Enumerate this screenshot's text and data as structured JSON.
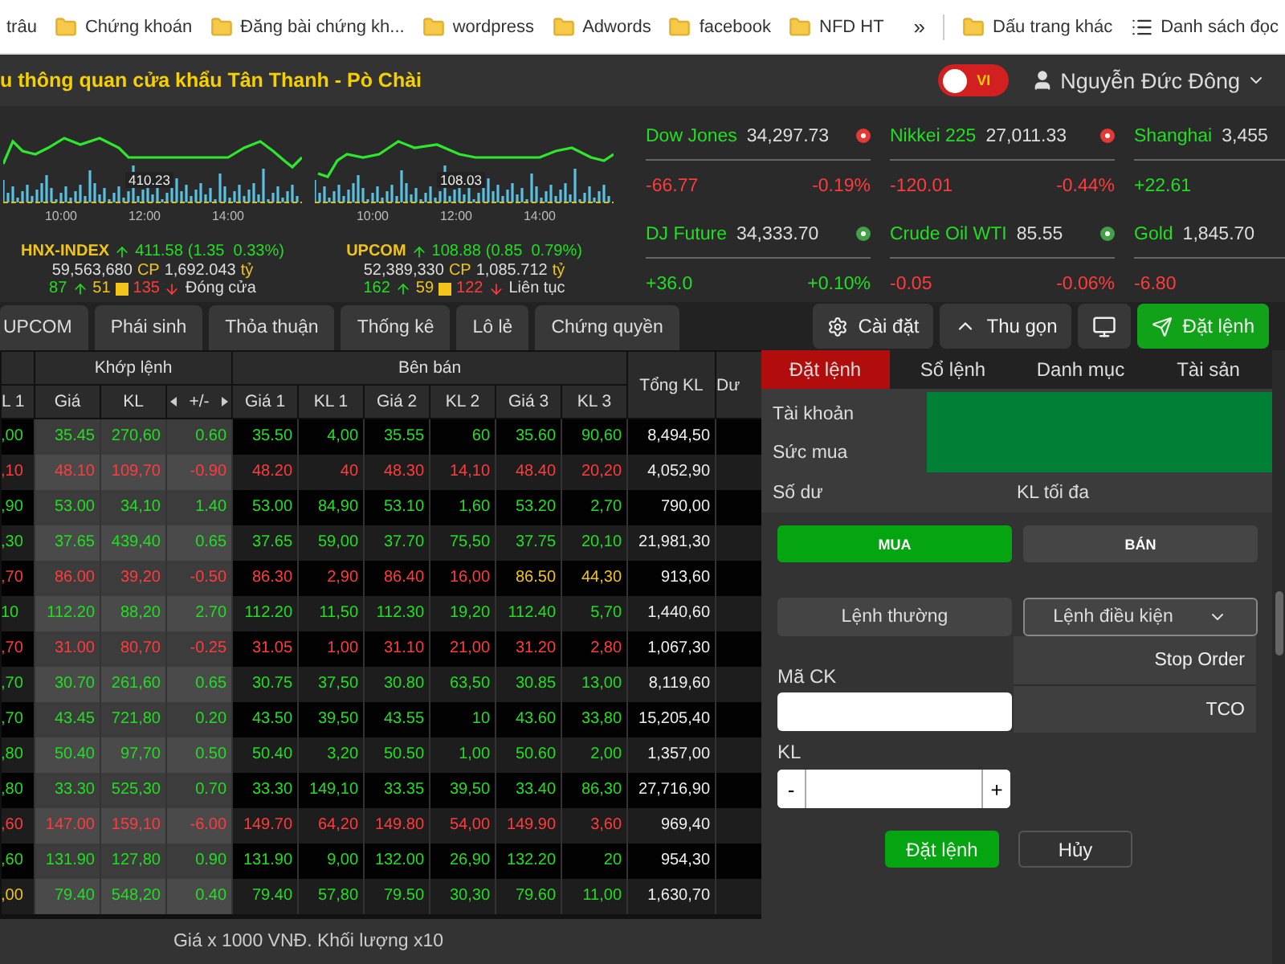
{
  "bookmarks": [
    {
      "label": "trâu",
      "kind": "page"
    },
    {
      "label": "Chứng khoán",
      "kind": "folder"
    },
    {
      "label": "Đăng bài chứng kh...",
      "kind": "folder"
    },
    {
      "label": "wordpress",
      "kind": "folder"
    },
    {
      "label": "Adwords",
      "kind": "folder"
    },
    {
      "label": "facebook",
      "kind": "folder"
    },
    {
      "label": "NFD HT",
      "kind": "folder"
    }
  ],
  "bookmarks_overflow": "»",
  "bookmarks_right": [
    {
      "label": "Dấu trang khác",
      "kind": "folder"
    },
    {
      "label": "Danh sách đọc",
      "kind": "reading_list"
    }
  ],
  "header": {
    "title": "u thông quan cửa khẩu Tân Thanh - Pò Chài",
    "language": {
      "label": "VI",
      "on": false
    },
    "user": "Nguyễn Đức Đông"
  },
  "index_panels": [
    {
      "chart_label": "410.23",
      "times": [
        "10:00",
        "12:00",
        "14:00"
      ],
      "name": "HNX-INDEX",
      "value": "411.58",
      "change": "(1.35  0.33%)",
      "volume": "59,563,680",
      "volume_unit": "CP",
      "turnover": "1,692.043",
      "turnover_unit": "tỷ",
      "advances": "87",
      "unchanged": "51",
      "declines": "135",
      "session": "Đóng cửa"
    },
    {
      "chart_label": "108.03",
      "times": [
        "10:00",
        "12:00",
        "14:00"
      ],
      "name": "UPCOM",
      "value": "108.88",
      "change": "(0.85  0.79%)",
      "volume": "52,389,330",
      "volume_unit": "CP",
      "turnover": "1,085.712",
      "turnover_unit": "tỷ",
      "advances": "162",
      "unchanged": "59",
      "declines": "122",
      "session": "Liên tục"
    }
  ],
  "world_indices": [
    {
      "name": "Dow Jones",
      "value": "34,297.73",
      "status": {
        "color": "#e53935"
      },
      "change": "-66.77",
      "percent": "-0.19%",
      "color": "#ff3b3b"
    },
    {
      "name": "Nikkei 225",
      "value": "27,011.33",
      "status": {
        "color": "#e53935"
      },
      "change": "-120.01",
      "percent": "-0.44%",
      "color": "#ff3b3b"
    },
    {
      "name": "Shanghai",
      "value": "3,455",
      "change": "+22.61",
      "color": "#22dd22"
    },
    {
      "name": "DJ Future",
      "value": "34,333.70",
      "status": {
        "color": "#43a047"
      },
      "change": "+36.0",
      "percent": "+0.10%",
      "color": "#22dd22"
    },
    {
      "name": "Crude Oil WTI",
      "value": "85.55",
      "status": {
        "color": "#43a047"
      },
      "change": "-0.05",
      "percent": "-0.06%",
      "color": "#ff3b3b"
    },
    {
      "name": "Gold",
      "value": "1,845.70",
      "change": "-6.80",
      "color": "#ff3b3b"
    }
  ],
  "board_tabs": [
    {
      "label": "UPCOM",
      "selected": false
    },
    {
      "label": "Phái sinh",
      "selected": false
    },
    {
      "label": "Thỏa thuận",
      "selected": false
    },
    {
      "label": "Thống kê",
      "selected": false
    },
    {
      "label": "Lô lẻ",
      "selected": false
    },
    {
      "label": "Chứng quyền",
      "selected": false
    }
  ],
  "toolbar": [
    {
      "label": "Cài đặt",
      "kind": "settings"
    },
    {
      "label": "Thu gọn",
      "kind": "collapse"
    },
    {
      "kind": "display"
    },
    {
      "label": "Đặt lệnh",
      "kind": "order"
    }
  ],
  "table": {
    "groups": [
      "Khớp lệnh",
      "Bên bán"
    ],
    "columns": [
      "L 1",
      "Giá",
      "KL",
      "+/-",
      "Giá 1",
      "KL 1",
      "Giá 2",
      "KL 2",
      "Giá 3",
      "KL 3",
      "Tổng KL",
      "Dư"
    ],
    "rows": [
      {
        "bid": {
          "text": ",00",
          "color": "#22dd22"
        },
        "price": "35.45",
        "volume": "270,60",
        "change": "0.60",
        "color": "#22dd22",
        "asks": [
          {
            "price": "35.50",
            "volume": "4,00",
            "color": "#22dd22"
          },
          {
            "price": "35.55",
            "volume": "60",
            "color": "#22dd22"
          },
          {
            "price": "35.60",
            "volume": "90,60",
            "color": "#22dd22"
          }
        ],
        "total": "8,494,50"
      },
      {
        "bid": {
          "text": ",10",
          "color": "#ff3b3b"
        },
        "price": "48.10",
        "volume": "109,70",
        "change": "-0.90",
        "color": "#ff3b3b",
        "asks": [
          {
            "price": "48.20",
            "volume": "40",
            "color": "#ff3b3b"
          },
          {
            "price": "48.30",
            "volume": "14,10",
            "color": "#ff3b3b"
          },
          {
            "price": "48.40",
            "volume": "20,20",
            "color": "#ff3b3b"
          }
        ],
        "total": "4,052,90"
      },
      {
        "bid": {
          "text": ",90",
          "color": "#22dd22"
        },
        "price": "53.00",
        "volume": "34,10",
        "change": "1.40",
        "color": "#22dd22",
        "asks": [
          {
            "price": "53.00",
            "volume": "84,90",
            "color": "#22dd22"
          },
          {
            "price": "53.10",
            "volume": "1,60",
            "color": "#22dd22"
          },
          {
            "price": "53.20",
            "volume": "2,70",
            "color": "#22dd22"
          }
        ],
        "total": "790,00"
      },
      {
        "bid": {
          "text": ",30",
          "color": "#22dd22"
        },
        "price": "37.65",
        "volume": "439,40",
        "change": "0.65",
        "color": "#22dd22",
        "asks": [
          {
            "price": "37.65",
            "volume": "59,00",
            "color": "#22dd22"
          },
          {
            "price": "37.70",
            "volume": "75,50",
            "color": "#22dd22"
          },
          {
            "price": "37.75",
            "volume": "20,10",
            "color": "#22dd22"
          }
        ],
        "total": "21,981,30"
      },
      {
        "bid": {
          "text": ",70",
          "color": "#ff3b3b"
        },
        "price": "86.00",
        "volume": "39,20",
        "change": "-0.50",
        "color": "#ff3b3b",
        "asks": [
          {
            "price": "86.30",
            "volume": "2,90",
            "color": "#ff3b3b"
          },
          {
            "price": "86.40",
            "volume": "16,00",
            "color": "#ff3b3b"
          },
          {
            "price": "86.50",
            "volume": "44,30",
            "color": "#f0c419"
          }
        ],
        "total": "913,60"
      },
      {
        "bid": {
          "text": "10",
          "color": "#22dd22"
        },
        "price": "112.20",
        "volume": "88,20",
        "change": "2.70",
        "color": "#22dd22",
        "asks": [
          {
            "price": "112.20",
            "volume": "11,50",
            "color": "#22dd22"
          },
          {
            "price": "112.30",
            "volume": "19,20",
            "color": "#22dd22"
          },
          {
            "price": "112.40",
            "volume": "5,70",
            "color": "#22dd22"
          }
        ],
        "total": "1,440,60"
      },
      {
        "bid": {
          "text": ",70",
          "color": "#ff3b3b"
        },
        "price": "31.00",
        "volume": "80,70",
        "change": "-0.25",
        "color": "#ff3b3b",
        "asks": [
          {
            "price": "31.05",
            "volume": "1,00",
            "color": "#ff3b3b"
          },
          {
            "price": "31.10",
            "volume": "21,00",
            "color": "#ff3b3b"
          },
          {
            "price": "31.20",
            "volume": "2,80",
            "color": "#ff3b3b"
          }
        ],
        "total": "1,067,30"
      },
      {
        "bid": {
          "text": ",70",
          "color": "#22dd22"
        },
        "price": "30.70",
        "volume": "261,60",
        "change": "0.65",
        "color": "#22dd22",
        "asks": [
          {
            "price": "30.75",
            "volume": "37,50",
            "color": "#22dd22"
          },
          {
            "price": "30.80",
            "volume": "63,50",
            "color": "#22dd22"
          },
          {
            "price": "30.85",
            "volume": "13,00",
            "color": "#22dd22"
          }
        ],
        "total": "8,119,60"
      },
      {
        "bid": {
          "text": ",70",
          "color": "#22dd22"
        },
        "price": "43.45",
        "volume": "721,80",
        "change": "0.20",
        "color": "#22dd22",
        "asks": [
          {
            "price": "43.50",
            "volume": "39,50",
            "color": "#22dd22"
          },
          {
            "price": "43.55",
            "volume": "10",
            "color": "#22dd22"
          },
          {
            "price": "43.60",
            "volume": "33,80",
            "color": "#22dd22"
          }
        ],
        "total": "15,205,40"
      },
      {
        "bid": {
          "text": ",80",
          "color": "#22dd22"
        },
        "price": "50.40",
        "volume": "97,70",
        "change": "0.50",
        "color": "#22dd22",
        "asks": [
          {
            "price": "50.40",
            "volume": "3,20",
            "color": "#22dd22"
          },
          {
            "price": "50.50",
            "volume": "1,00",
            "color": "#22dd22"
          },
          {
            "price": "50.60",
            "volume": "2,00",
            "color": "#22dd22"
          }
        ],
        "total": "1,357,00"
      },
      {
        "bid": {
          "text": ",80",
          "color": "#22dd22"
        },
        "price": "33.30",
        "volume": "525,30",
        "change": "0.70",
        "color": "#22dd22",
        "asks": [
          {
            "price": "33.30",
            "volume": "149,10",
            "color": "#22dd22"
          },
          {
            "price": "33.35",
            "volume": "39,50",
            "color": "#22dd22"
          },
          {
            "price": "33.40",
            "volume": "86,30",
            "color": "#22dd22"
          }
        ],
        "total": "27,716,90"
      },
      {
        "bid": {
          "text": ",60",
          "color": "#ff3b3b"
        },
        "price": "147.00",
        "volume": "159,10",
        "change": "-6.00",
        "color": "#ff3b3b",
        "asks": [
          {
            "price": "149.70",
            "volume": "64,20",
            "color": "#ff3b3b"
          },
          {
            "price": "149.80",
            "volume": "54,00",
            "color": "#ff3b3b"
          },
          {
            "price": "149.90",
            "volume": "3,60",
            "color": "#ff3b3b"
          }
        ],
        "total": "969,40"
      },
      {
        "bid": {
          "text": ",60",
          "color": "#22dd22"
        },
        "price": "131.90",
        "volume": "127,80",
        "change": "0.90",
        "color": "#22dd22",
        "asks": [
          {
            "price": "131.90",
            "volume": "9,00",
            "color": "#22dd22"
          },
          {
            "price": "132.00",
            "volume": "26,90",
            "color": "#22dd22"
          },
          {
            "price": "132.20",
            "volume": "20",
            "color": "#22dd22"
          }
        ],
        "total": "954,30"
      },
      {
        "bid": {
          "text": ",00",
          "color": "#f0c419"
        },
        "price": "79.40",
        "volume": "548,20",
        "change": "0.40",
        "color": "#22dd22",
        "asks": [
          {
            "price": "79.40",
            "volume": "57,80",
            "color": "#22dd22"
          },
          {
            "price": "79.50",
            "volume": "30,30",
            "color": "#22dd22"
          },
          {
            "price": "79.60",
            "volume": "11,00",
            "color": "#22dd22"
          }
        ],
        "total": "1,630,70"
      }
    ],
    "footer": "Giá x 1000 VNĐ. Khối lượng x10"
  },
  "order_panel": {
    "tabs": [
      {
        "label": "Đặt lệnh",
        "selected": true
      },
      {
        "label": "Sổ lệnh",
        "selected": false
      },
      {
        "label": "Danh mục",
        "selected": false
      },
      {
        "label": "Tài sản",
        "selected": false
      }
    ],
    "account_label": "Tài khoản",
    "buying_power_label": "Sức mua",
    "balance_label": "Số dư",
    "max_label": "KL tối đa",
    "sides": [
      {
        "label": "MUA",
        "selected": true
      },
      {
        "label": "BÁN",
        "selected": false
      }
    ],
    "order_types": [
      {
        "label": "Lệnh thường",
        "selected": false
      },
      {
        "label": "Lệnh điều kiện",
        "selected": true
      }
    ],
    "dropdown": {
      "expanded": true,
      "options": [
        "Stop Order",
        "TCO"
      ]
    },
    "symbol_label": "Mã CK",
    "quantity_label": "KL",
    "minus": "-",
    "plus": "+",
    "submit": "Đặt lệnh",
    "cancel": "Hủy"
  }
}
